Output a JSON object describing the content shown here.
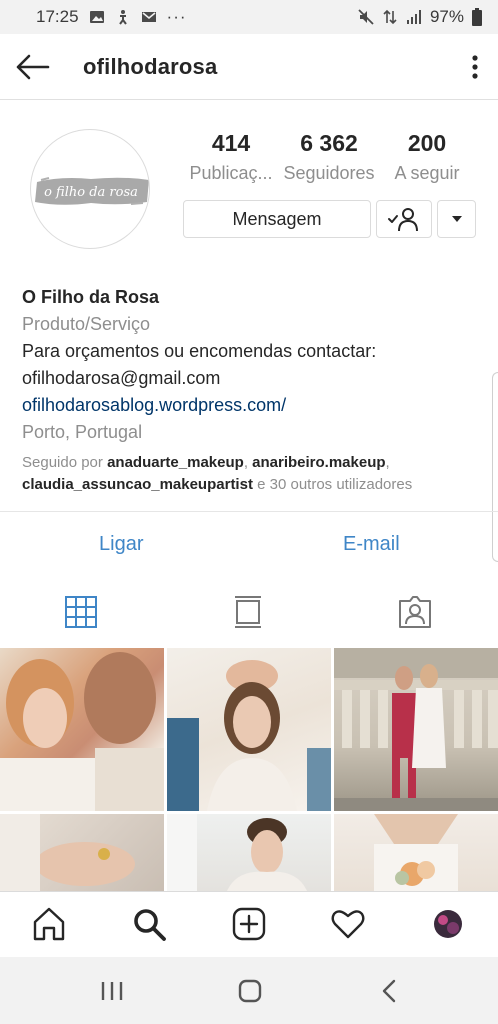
{
  "status_bar": {
    "time": "17:25",
    "dots": "···",
    "battery": "97%"
  },
  "header": {
    "username": "ofilhodarosa"
  },
  "avatar": {
    "logo_text": "o filho da rosa"
  },
  "stats": [
    {
      "value": "414",
      "label": "Publicaç..."
    },
    {
      "value": "6 362",
      "label": "Seguidores"
    },
    {
      "value": "200",
      "label": "A seguir"
    }
  ],
  "buttons": {
    "message": "Mensagem"
  },
  "bio": {
    "name": "O Filho da Rosa",
    "category": "Produto/Serviço",
    "text": "Para orçamentos ou encomendas contactar:",
    "email": "ofilhodarosa@gmail.com",
    "website": "ofilhodarosablog.wordpress.com/",
    "location": "Porto, Portugal",
    "followed_prefix": "Seguido por ",
    "followed_user1": "anaduarte_makeup",
    "followed_sep1": ", ",
    "followed_user2": "anaribeiro.makeup",
    "followed_sep2": ",",
    "followed_user3": "claudia_assuncao_makeupartist",
    "followed_suffix": " e 30 outros utilizadores"
  },
  "actions": {
    "call": "Ligar",
    "email": "E-mail"
  },
  "colors": {
    "accent_blue": "#3f86c7",
    "link_dark_blue": "#003569",
    "secondary_text": "#8e8e8e"
  }
}
